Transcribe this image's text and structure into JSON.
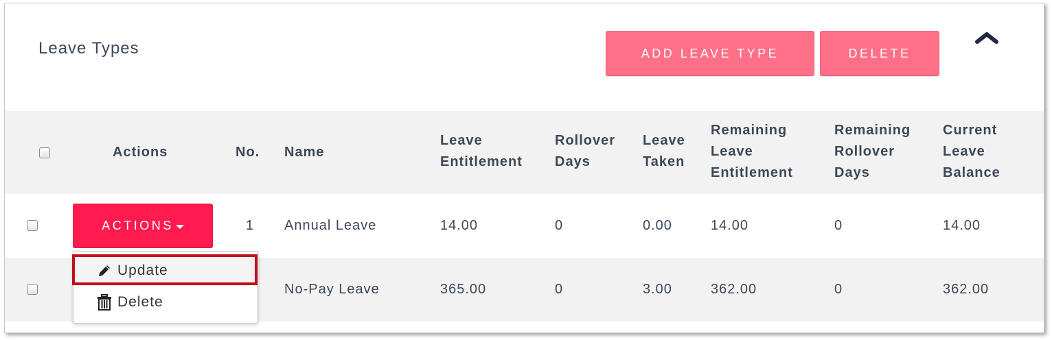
{
  "card": {
    "title": "Leave Types",
    "add_button": "ADD LEAVE TYPE",
    "delete_button": "DELETE"
  },
  "table": {
    "headers": {
      "actions": "Actions",
      "no": "No.",
      "name": "Name",
      "leave_entitlement": [
        "Leave",
        "Entitlement"
      ],
      "rollover_days": [
        "Rollover",
        "Days"
      ],
      "leave_taken": [
        "Leave",
        "Taken"
      ],
      "remaining_leave_entitlement": [
        "Remaining",
        "Leave",
        "Entitlement"
      ],
      "remaining_rollover_days": [
        "Remaining",
        "Rollover",
        "Days"
      ],
      "current_leave_balance": [
        "Current",
        "Leave",
        "Balance"
      ]
    },
    "rows": [
      {
        "no": "1",
        "name": "Annual Leave",
        "leave_entitlement": "14.00",
        "rollover_days": "0",
        "leave_taken": "0.00",
        "remaining_leave_entitlement": "14.00",
        "remaining_rollover_days": "0",
        "current_leave_balance": "14.00"
      },
      {
        "no": "",
        "name": "No-Pay Leave",
        "leave_entitlement": "365.00",
        "rollover_days": "0",
        "leave_taken": "3.00",
        "remaining_leave_entitlement": "362.00",
        "remaining_rollover_days": "0",
        "current_leave_balance": "362.00"
      }
    ]
  },
  "actions_dropdown": {
    "button_label": "ACTIONS",
    "items": [
      {
        "label": "Update",
        "icon": "pencil-icon"
      },
      {
        "label": "Delete",
        "icon": "trash-icon"
      }
    ]
  },
  "colors": {
    "primary_pink": "#ff6f87",
    "actions_red": "#ff1a4f",
    "highlight_red": "#c0101b",
    "text": "#3c4858"
  }
}
